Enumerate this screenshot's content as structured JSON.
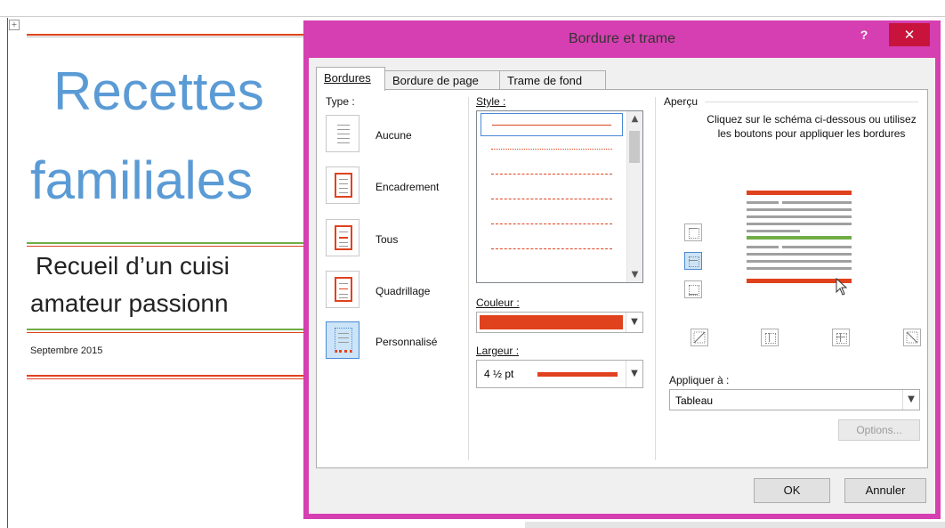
{
  "document": {
    "title_line1": "Recettes",
    "title_line2": "familiales",
    "subtitle_line1": "Recueil d’un cuisi",
    "subtitle_line2": "amateur passionn",
    "date": "Septembre 2015"
  },
  "dialog": {
    "title": "Bordure et trame",
    "help": "?",
    "close": "✕",
    "tabs": [
      {
        "label": "Bordures",
        "active": true
      },
      {
        "label": "Bordure de page",
        "active": false
      },
      {
        "label": "Trame de fond",
        "active": false
      }
    ],
    "type_label": "Type :",
    "types": [
      {
        "label": "Aucune",
        "icon": "border-none-icon"
      },
      {
        "label": "Encadrement",
        "icon": "border-box-icon"
      },
      {
        "label": "Tous",
        "icon": "border-all-icon"
      },
      {
        "label": "Quadrillage",
        "icon": "border-grid-icon"
      },
      {
        "label": "Personnalisé",
        "icon": "border-custom-icon",
        "selected": true
      }
    ],
    "style_label": "Style :",
    "color_label": "Couleur :",
    "color_value": "#e0421e",
    "width_label": "Largeur :",
    "width_value": "4 ½ pt",
    "preview_label": "Aperçu",
    "preview_help": "Cliquez sur le schéma ci-dessous ou utilisez les boutons pour appliquer les bordures",
    "apply_label": "Appliquer à :",
    "apply_value": "Tableau",
    "options_button": "Options...",
    "ok_button": "OK",
    "cancel_button": "Annuler"
  },
  "colors": {
    "accent_border": "#e0421e",
    "window_frame": "#d63fb1",
    "title_blue": "#5b9bd5",
    "green_rule": "#70ad47"
  }
}
